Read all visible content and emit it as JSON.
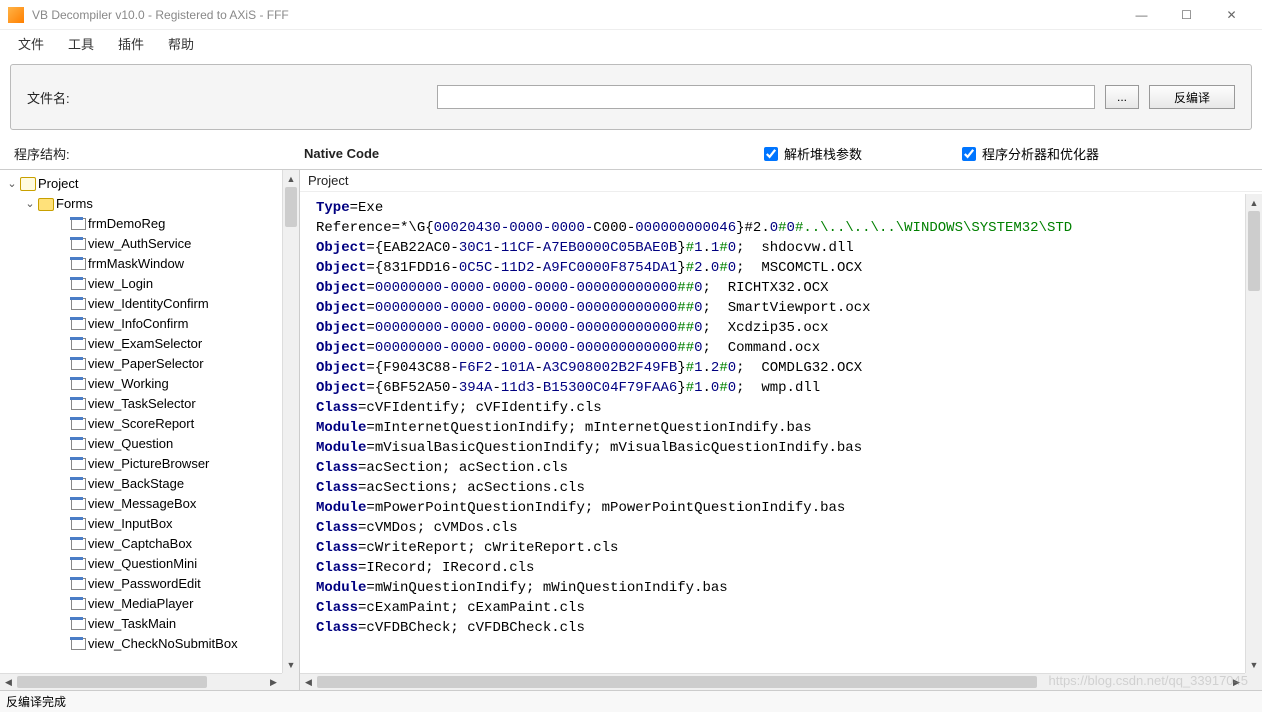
{
  "window": {
    "title": "VB Decompiler v10.0 - Registered to AXiS - FFF"
  },
  "menubar": [
    "文件",
    "工具",
    "插件",
    "帮助"
  ],
  "toolbar": {
    "filename_label": "文件名:",
    "filename_value": "",
    "browse_label": "...",
    "decompile_label": "反编译"
  },
  "options": {
    "struct_label": "程序结构:",
    "native_label": "Native Code",
    "check1_label": "解析堆栈参数",
    "check1_checked": true,
    "check2_label": "程序分析器和优化器",
    "check2_checked": true
  },
  "tree": {
    "root": "Project",
    "folder": "Forms",
    "items": [
      "frmDemoReg",
      "view_AuthService",
      "frmMaskWindow",
      "view_Login",
      "view_IdentityConfirm",
      "view_InfoConfirm",
      "view_ExamSelector",
      "view_PaperSelector",
      "view_Working",
      "view_TaskSelector",
      "view_ScoreReport",
      "view_Question",
      "view_PictureBrowser",
      "view_BackStage",
      "view_MessageBox",
      "view_InputBox",
      "view_CaptchaBox",
      "view_QuestionMini",
      "view_PasswordEdit",
      "view_MediaPlayer",
      "view_TaskMain",
      "view_CheckNoSubmitBox"
    ]
  },
  "code": {
    "header": "Project",
    "lines": [
      {
        "t": "kv",
        "k": "Type",
        "v": "Exe"
      },
      {
        "t": "ref",
        "pre": "Reference=*\\G{",
        "g1": "00020430-0000-0000-",
        "g2": "C000-",
        "g3": "000000000046",
        "post": "}#2.",
        "n1": "0",
        "s1": "#",
        "n2": "0",
        "s2": "#..\\..\\..\\..\\WINDOWS\\SYSTEM32\\STD"
      },
      {
        "t": "obj",
        "g": "{EAB22AC0-30C1-11CF-A7EB0000C05BAE0B}",
        "v": "#1.1#0",
        "d": "shdocvw.dll"
      },
      {
        "t": "obj",
        "g": "{831FDD16-0C5C-11D2-A9FC0000F8754DA1}",
        "v": "#2.0#0",
        "d": "MSCOMCTL.OCX"
      },
      {
        "t": "obj0",
        "d": "RICHTX32.OCX"
      },
      {
        "t": "obj0",
        "d": "SmartViewport.ocx"
      },
      {
        "t": "obj0",
        "d": "Xcdzip35.ocx"
      },
      {
        "t": "obj0",
        "d": "Command.ocx"
      },
      {
        "t": "obj",
        "g": "{F9043C88-F6F2-101A-A3C908002B2F49FB}",
        "v": "#1.2#0",
        "d": "COMDLG32.OCX"
      },
      {
        "t": "obj",
        "g": "{6BF52A50-394A-11d3-B15300C04F79FAA6}",
        "v": "#1.0#0",
        "d": "wmp.dll"
      },
      {
        "t": "cls",
        "n": "cVFIdentify",
        "f": "cVFIdentify.cls"
      },
      {
        "t": "mod",
        "n": "mInternetQuestionIndify",
        "f": "mInternetQuestionIndify.bas"
      },
      {
        "t": "mod",
        "n": "mVisualBasicQuestionIndify",
        "f": "mVisualBasicQuestionIndify.bas"
      },
      {
        "t": "cls",
        "n": "acSection",
        "f": "acSection.cls"
      },
      {
        "t": "cls",
        "n": "acSections",
        "f": "acSections.cls"
      },
      {
        "t": "mod",
        "n": "mPowerPointQuestionIndify",
        "f": "mPowerPointQuestionIndify.bas"
      },
      {
        "t": "cls",
        "n": "cVMDos",
        "f": "cVMDos.cls"
      },
      {
        "t": "cls",
        "n": "cWriteReport",
        "f": "cWriteReport.cls"
      },
      {
        "t": "cls",
        "n": "IRecord",
        "f": "IRecord.cls"
      },
      {
        "t": "mod",
        "n": "mWinQuestionIndify",
        "f": "mWinQuestionIndify.bas"
      },
      {
        "t": "cls",
        "n": "cExamPaint",
        "f": "cExamPaint.cls"
      },
      {
        "t": "cls",
        "n": "cVFDBCheck",
        "f": "cVFDBCheck.cls"
      }
    ]
  },
  "status": "反编译完成",
  "watermark": "https://blog.csdn.net/qq_33917045"
}
